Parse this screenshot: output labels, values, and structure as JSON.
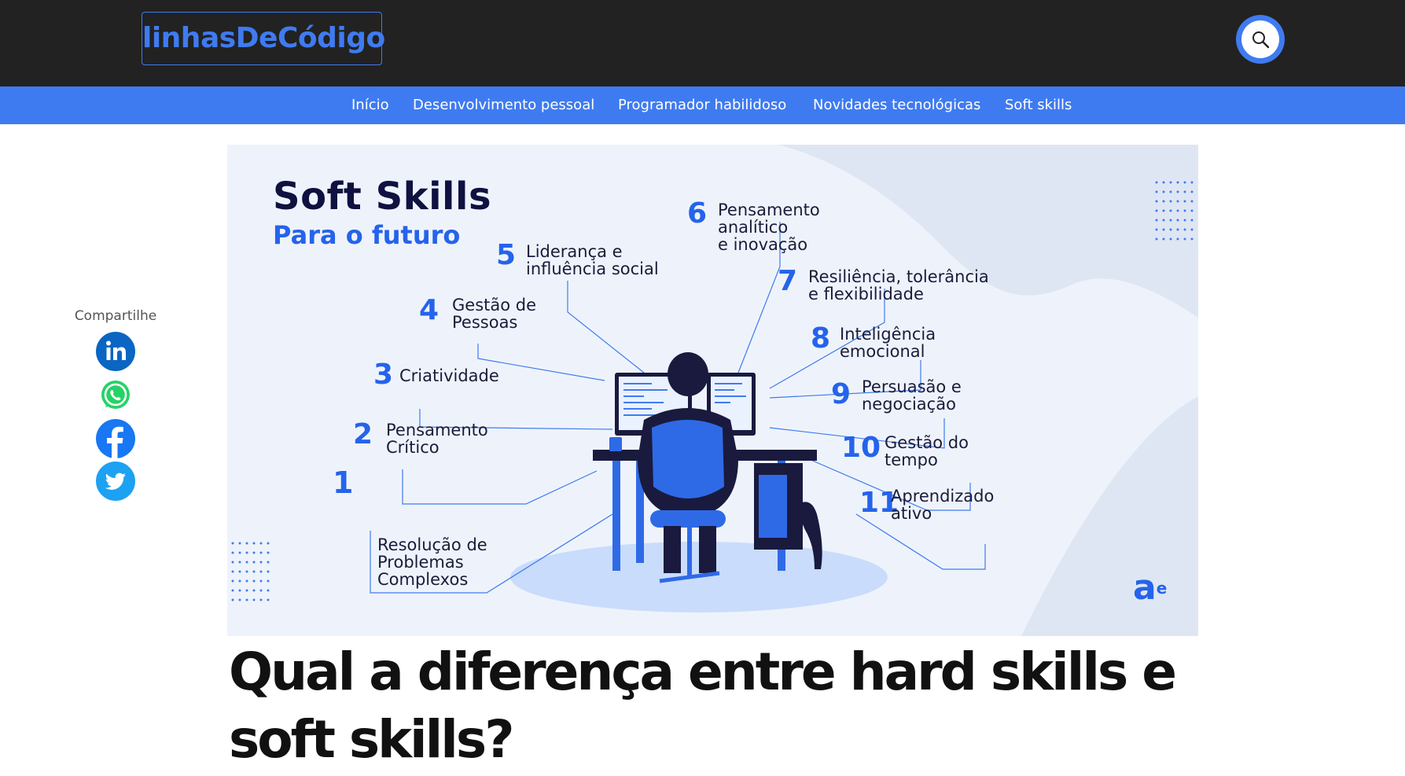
{
  "site": {
    "logo": "linhasDeCódigo"
  },
  "nav": {
    "items": [
      "Início",
      "Desenvolvimento pessoal",
      "Programador habilidoso",
      "Novidades tecnológicas",
      "Soft skills"
    ]
  },
  "share": {
    "title": "Compartilhe",
    "networks": [
      "linkedin-icon",
      "whatsapp-icon",
      "facebook-icon",
      "twitter-icon"
    ]
  },
  "hero": {
    "title": "Soft Skills",
    "subtitle": "Para o futuro",
    "brand_mark": "a e",
    "skills": [
      {
        "num": "1",
        "label": [
          "Resolução de",
          "Problemas",
          "Complexos"
        ]
      },
      {
        "num": "2",
        "label": [
          "Pensamento",
          "Crítico"
        ]
      },
      {
        "num": "3",
        "label": [
          "Criatividade"
        ]
      },
      {
        "num": "4",
        "label": [
          "Gestão de",
          "Pessoas"
        ]
      },
      {
        "num": "5",
        "label": [
          "Liderança e",
          "influência social"
        ]
      },
      {
        "num": "6",
        "label": [
          "Pensamento",
          "analítico",
          "e inovação"
        ]
      },
      {
        "num": "7",
        "label": [
          "Resiliência, tolerância",
          "e flexibilidade"
        ]
      },
      {
        "num": "8",
        "label": [
          "Inteligência",
          "emocional"
        ]
      },
      {
        "num": "9",
        "label": [
          "Persuasão e",
          "negociação"
        ]
      },
      {
        "num": "10",
        "label": [
          "Gestão do",
          "tempo"
        ]
      },
      {
        "num": "11",
        "label": [
          "Aprendizado",
          "ativo"
        ]
      }
    ]
  },
  "article": {
    "title": "Qual a diferença entre hard skills e soft skills?"
  },
  "colors": {
    "accent": "#3f7bf0",
    "topbar": "#222222",
    "skill_number": "#2563eb",
    "title_dark": "#0f1140"
  }
}
